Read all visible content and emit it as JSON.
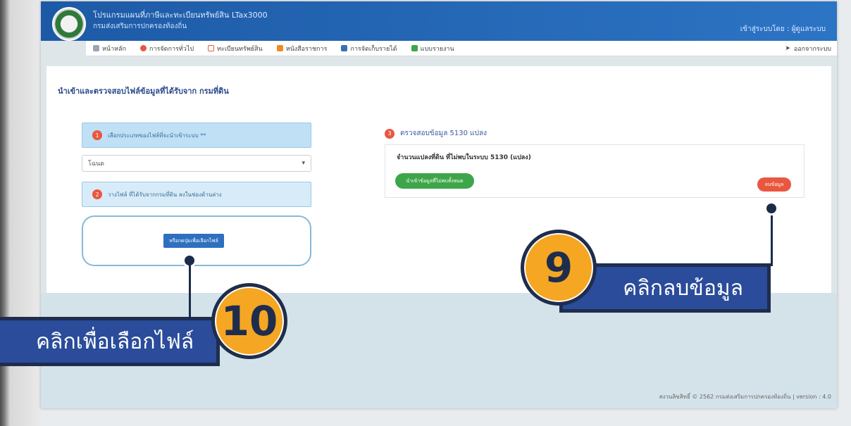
{
  "header": {
    "title": "โปรแกรมแผนที่ภาษีและทะเบียนทรัพย์สิน LTax3000",
    "subtitle": "กรมส่งเสริมการปกครองท้องถิ่น",
    "user_label": "เข้าสู่ระบบโดย : ผู้ดูแลระบบ"
  },
  "nav": {
    "items": [
      {
        "label": "หน้าหลัก",
        "icon": "home-icon"
      },
      {
        "label": "การจัดการทั่วไป",
        "icon": "gear-icon"
      },
      {
        "label": "ทะเบียนทรัพย์สิน",
        "icon": "book-icon"
      },
      {
        "label": "หนังสือราชการ",
        "icon": "document-icon"
      },
      {
        "label": "การจัดเก็บรายได้",
        "icon": "ledger-icon"
      },
      {
        "label": "แบบรายงาน",
        "icon": "report-icon"
      }
    ],
    "logout": "ออกจากระบบ"
  },
  "page": {
    "title": "นำเข้าและตรวจสอบไฟล์ข้อมูลที่ได้รับจาก กรมที่ดิน"
  },
  "steps": {
    "step1": {
      "number": "1",
      "text": "เลือกประเภทของไฟล์ที่จะนำเข้าระบบ **"
    },
    "select_value": "โฉนด",
    "step2": {
      "number": "2",
      "text": "วางไฟล์ ที่ได้รับจากกรมที่ดิน ลงในช่องด้านล่าง"
    },
    "upload_button": "หรือกดปุ่มเพื่อเลือกไฟล์",
    "step3": {
      "number": "3",
      "text": "ตรวจสอบข้อมูล 5130 แปลง"
    },
    "info_text": "จำนวนแปลงที่ดิน ที่ไม่พบในระบบ 5130 (แปลง)",
    "import_button": "นำเข้าข้อมูลที่ไม่พบทั้งหมด",
    "delete_button": "ลบข้อมูล"
  },
  "footer": "สงวนลิขสิทธิ์ © 2562 กรมส่งเสริมการปกครองท้องถิ่น | version : 4.0",
  "callouts": {
    "c9": {
      "number": "9",
      "label": "คลิกลบข้อมูล"
    },
    "c10": {
      "number": "10",
      "label": "คลิกเพื่อเลือกไฟล์"
    }
  }
}
